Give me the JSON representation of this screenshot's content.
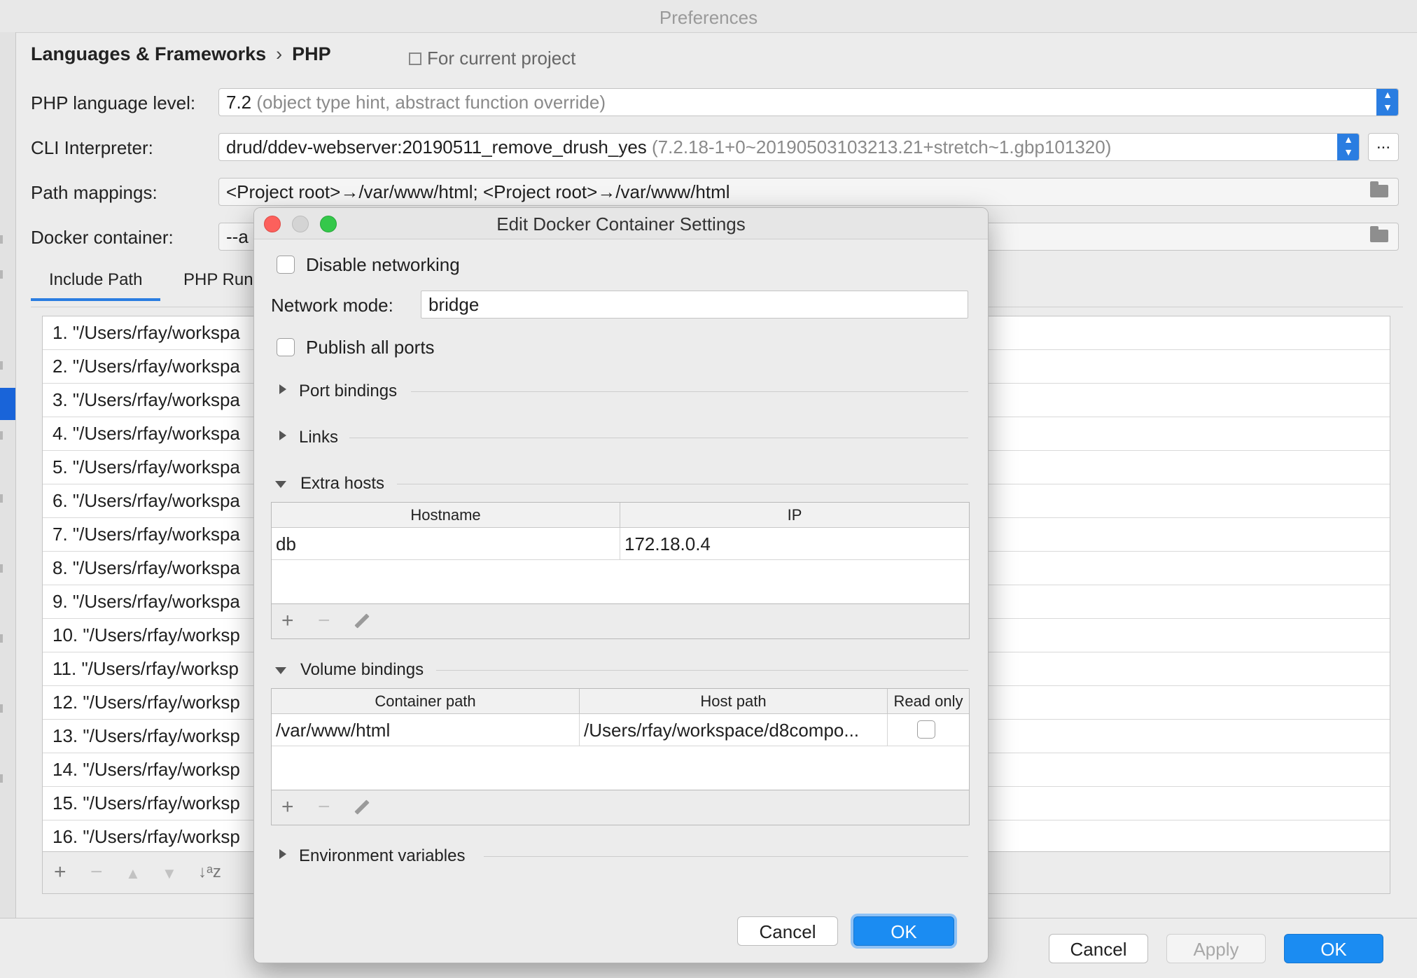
{
  "window": {
    "title": "Preferences"
  },
  "breadcrumb": {
    "section": "Languages & Frameworks",
    "separator": "›",
    "page": "PHP"
  },
  "current_project": "For current project",
  "php_level": {
    "label": "PHP language level:",
    "value": "7.2",
    "detail": "(object type hint, abstract function override)"
  },
  "cli": {
    "label": "CLI Interpreter:",
    "value": "drud/ddev-webserver:20190511_remove_drush_yes",
    "detail": "(7.2.18-1+0~20190503103213.21+stretch~1.gbp101320)",
    "more": "..."
  },
  "path_mappings": {
    "label": "Path mappings:",
    "value": "<Project root>→/var/www/html; <Project root>→/var/www/html"
  },
  "docker_container": {
    "label": "Docker container:",
    "value": "--a"
  },
  "tabs": [
    {
      "label": "Include Path"
    },
    {
      "label": "PHP Run"
    }
  ],
  "include_paths": [
    "1. \"/Users/rfay/workspa",
    "2. \"/Users/rfay/workspa",
    "3. \"/Users/rfay/workspa",
    "4. \"/Users/rfay/workspa",
    "5. \"/Users/rfay/workspa",
    "6. \"/Users/rfay/workspa",
    "7. \"/Users/rfay/workspa",
    "8. \"/Users/rfay/workspa",
    "9. \"/Users/rfay/workspa",
    "10. \"/Users/rfay/worksp",
    "11. \"/Users/rfay/worksp",
    "12. \"/Users/rfay/worksp",
    "13. \"/Users/rfay/worksp",
    "14. \"/Users/rfay/worksp",
    "15. \"/Users/rfay/worksp",
    "16. \"/Users/rfay/worksp"
  ],
  "list_toolbar": {
    "add": "+",
    "remove": "−",
    "up": "▲",
    "down": "▼",
    "sort": "↓ᵃz"
  },
  "footer": {
    "cancel": "Cancel",
    "apply": "Apply",
    "ok": "OK"
  },
  "dialog": {
    "title": "Edit Docker Container Settings",
    "disable_networking": "Disable networking",
    "network_mode_label": "Network mode:",
    "network_mode_value": "bridge",
    "publish_all_ports": "Publish all ports",
    "sections": {
      "port_bindings": "Port bindings",
      "links": "Links",
      "extra_hosts": "Extra hosts",
      "volume_bindings": "Volume bindings",
      "environment_variables": "Environment variables"
    },
    "extra_hosts": {
      "columns": [
        "Hostname",
        "IP"
      ],
      "rows": [
        {
          "hostname": "db",
          "ip": "172.18.0.4"
        }
      ]
    },
    "volume_bindings": {
      "columns": [
        "Container path",
        "Host path",
        "Read only"
      ],
      "rows": [
        {
          "container": "/var/www/html",
          "host": "/Users/rfay/workspace/d8compo...",
          "read_only": false
        }
      ]
    },
    "toolbar": {
      "add": "+",
      "remove": "−"
    },
    "cancel": "Cancel",
    "ok": "OK"
  },
  "colors": {
    "accent": "#1b8cf2",
    "traffic_close": "#fc605c",
    "traffic_min": "#d0d0d0",
    "traffic_max": "#34c84a"
  }
}
